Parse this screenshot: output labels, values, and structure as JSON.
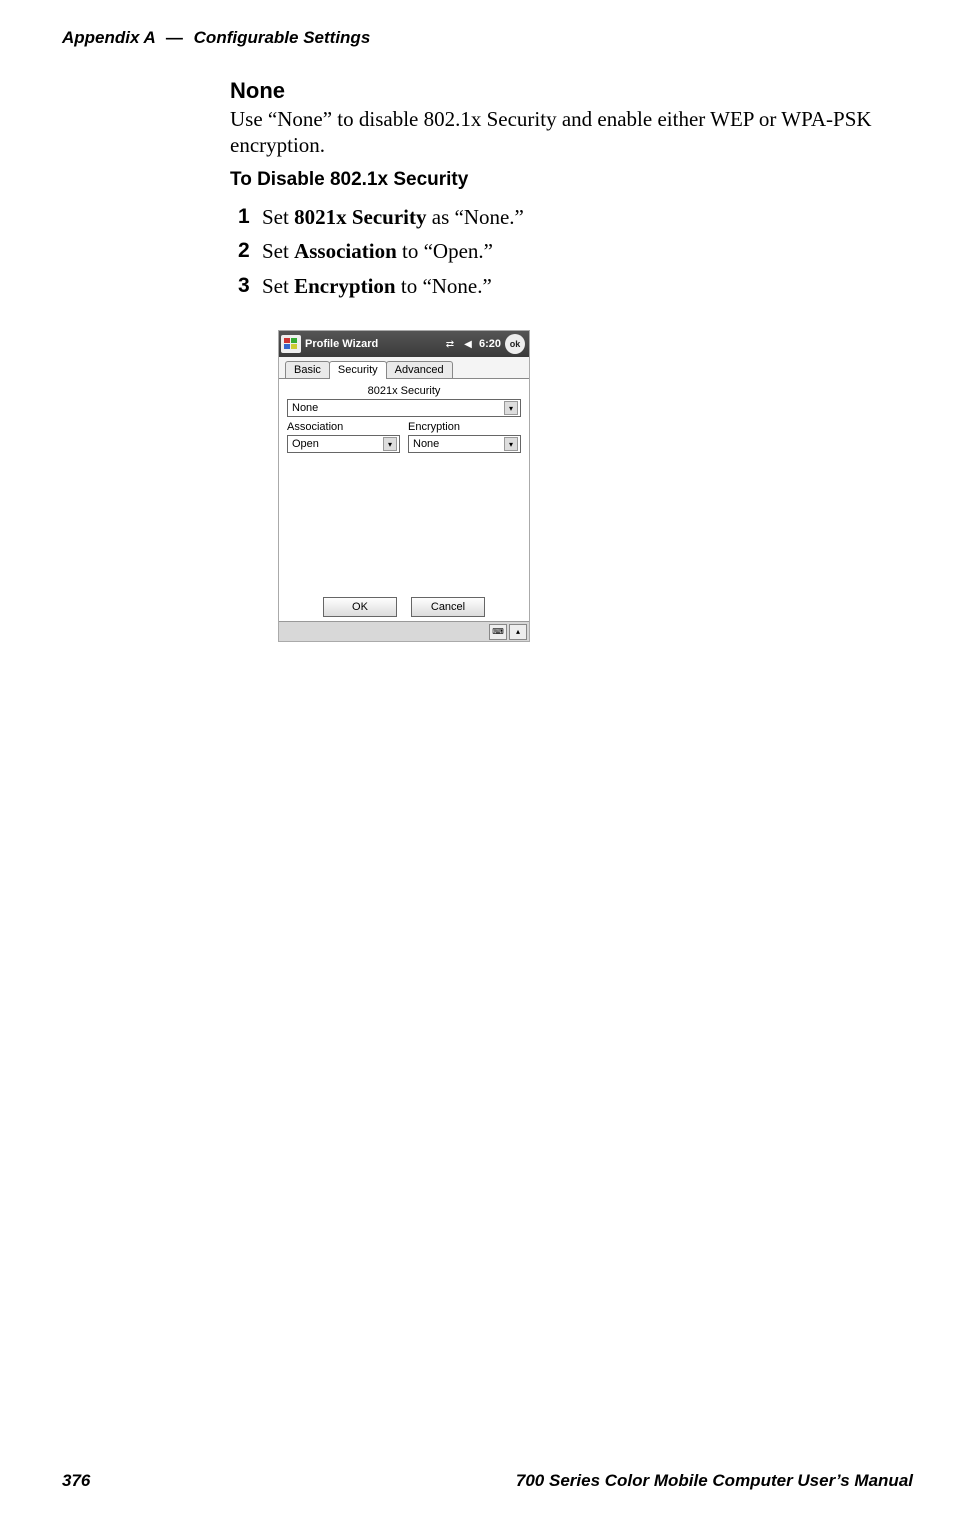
{
  "header": {
    "appendix": "Appendix A",
    "sep": "—",
    "title": "Configurable Settings"
  },
  "section": {
    "heading": "None",
    "body": "Use “None” to disable 802.1x Security and enable either WEP or WPA-PSK encryption.",
    "subheading": "To Disable 802.1x Security",
    "steps": [
      {
        "num": "1",
        "pre": "Set ",
        "bold": "8021x Security",
        "post": " as “None.”"
      },
      {
        "num": "2",
        "pre": "Set ",
        "bold": "Association",
        "post": " to “Open.”"
      },
      {
        "num": "3",
        "pre": "Set ",
        "bold": "Encryption",
        "post": " to “None.”"
      }
    ]
  },
  "screenshot": {
    "title": "Profile Wizard",
    "time": "6:20",
    "ok": "ok",
    "tabs": {
      "basic": "Basic",
      "security": "Security",
      "advanced": "Advanced"
    },
    "security_label": "8021x Security",
    "security_value": "None",
    "assoc_label": "Association",
    "assoc_value": "Open",
    "enc_label": "Encryption",
    "enc_value": "None",
    "buttons": {
      "ok": "OK",
      "cancel": "Cancel"
    }
  },
  "footer": {
    "page": "376",
    "manual": "700 Series Color Mobile Computer User’s Manual"
  }
}
